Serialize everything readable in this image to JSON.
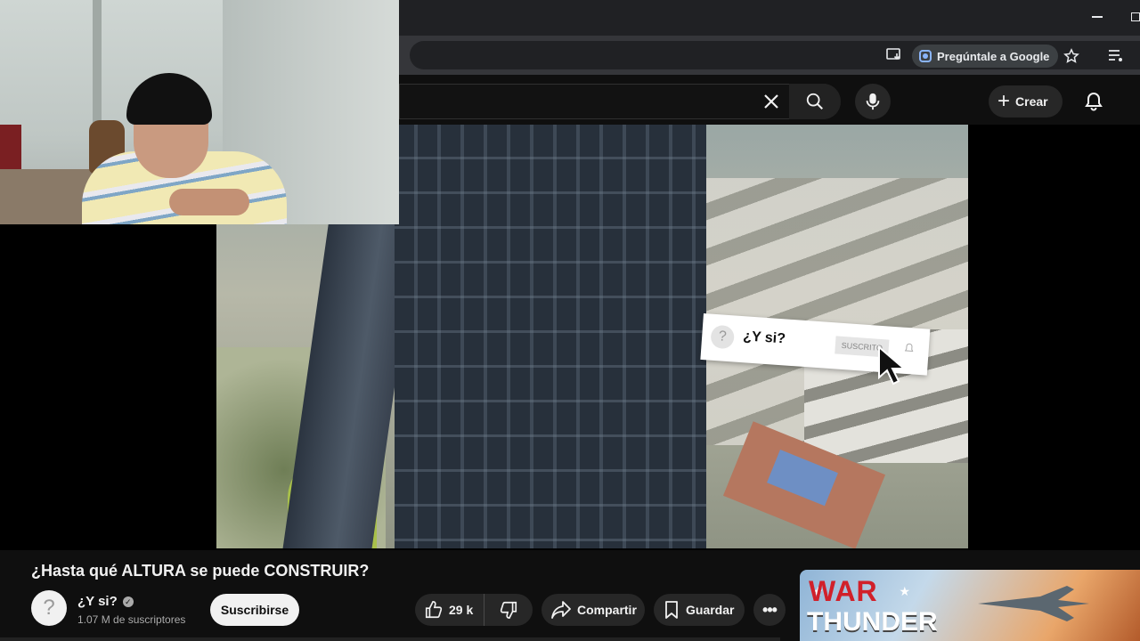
{
  "browser": {
    "ask_google_label": "Pregúntale a Google"
  },
  "header": {
    "create_label": "Crear"
  },
  "video_overlay": {
    "channel_name": "¿Y si?",
    "subscribed_label": "SUSCRITO"
  },
  "video": {
    "title": "¿Hasta qué ALTURA se puede CONSTRUIR?"
  },
  "channel": {
    "name": "¿Y si?",
    "subscribers": "1.07 M de suscriptores",
    "avatar_glyph": "?",
    "verified_glyph": "✓"
  },
  "actions": {
    "subscribe_label": "Suscribirse",
    "likes": "29 k",
    "share_label": "Compartir",
    "save_label": "Guardar",
    "more_label": "•••"
  },
  "ad": {
    "logo_top": "WAR",
    "logo_bottom": "THUNDER"
  },
  "colors": {
    "background": "#0f0f0f",
    "chrome_toolbar": "#35363a",
    "pill": "#272727",
    "subscribe_bg": "#f1f1f1",
    "accent_blue": "#8ab4f8"
  },
  "icons": [
    "install-app-icon",
    "google-lens-icon",
    "star-icon",
    "reading-list-icon",
    "close-icon",
    "search-icon",
    "mic-icon",
    "plus-icon",
    "bell-icon",
    "thumbs-up-icon",
    "thumbs-down-icon",
    "share-icon",
    "bookmark-icon",
    "more-icon",
    "cursor-icon"
  ]
}
